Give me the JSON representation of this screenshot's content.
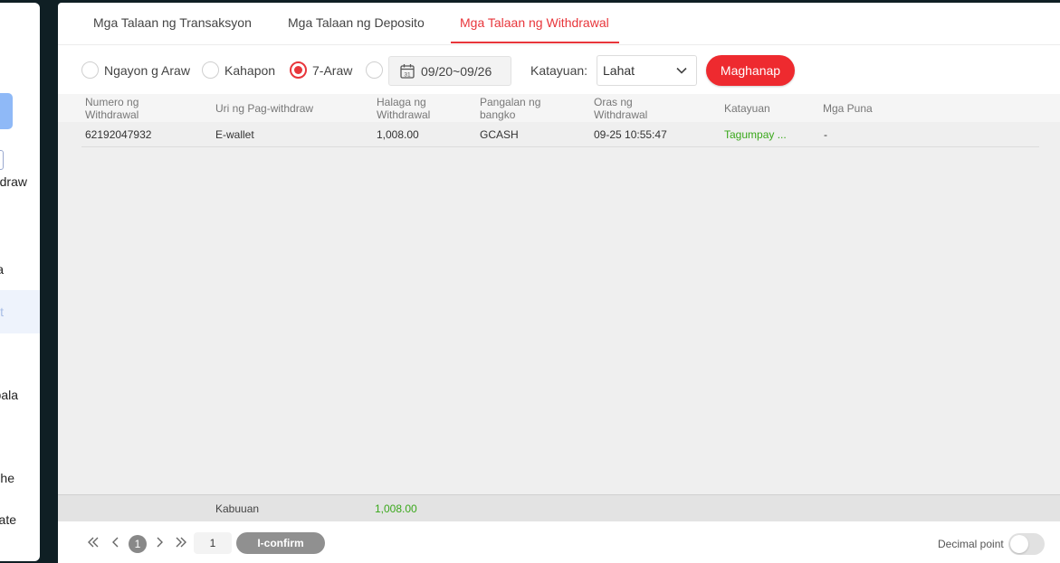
{
  "sidebar": {
    "items": [
      "draw",
      "a",
      "t",
      "bala",
      "he",
      "ate"
    ]
  },
  "tabs": [
    {
      "label": "Mga Talaan ng Transaksyon"
    },
    {
      "label": "Mga Talaan ng Deposito"
    },
    {
      "label": "Mga Talaan ng Withdrawal"
    }
  ],
  "filters": {
    "today": "Ngayon g Araw",
    "yesterday": "Kahapon",
    "seven_days": "7-Araw",
    "date_range": "09/20~09/26",
    "status_label": "Katayuan:",
    "status_value": "Lahat",
    "search_label": "Maghanap"
  },
  "table": {
    "headers": {
      "number": [
        "Numero ng",
        "Withdrawal"
      ],
      "type": "Uri ng Pag-withdraw",
      "amount": [
        "Halaga ng",
        "Withdrawal"
      ],
      "bank": [
        "Pangalan ng",
        "bangko"
      ],
      "time": [
        "Oras ng",
        "Withdrawal"
      ],
      "status": "Katayuan",
      "remarks": "Mga Puna"
    },
    "rows": [
      {
        "number": "62192047932",
        "type": "E-wallet",
        "amount": "1,008.00",
        "bank": "GCASH",
        "time": "09-25 10:55:47",
        "status": "Tagumpay ...",
        "remarks": "-"
      }
    ]
  },
  "totals": {
    "label": "Kabuuan",
    "value": "1,008.00"
  },
  "pager": {
    "current_page": "1",
    "page_input": "1",
    "confirm_label": "I-confirm"
  },
  "decimal": {
    "label": "Decimal point"
  }
}
